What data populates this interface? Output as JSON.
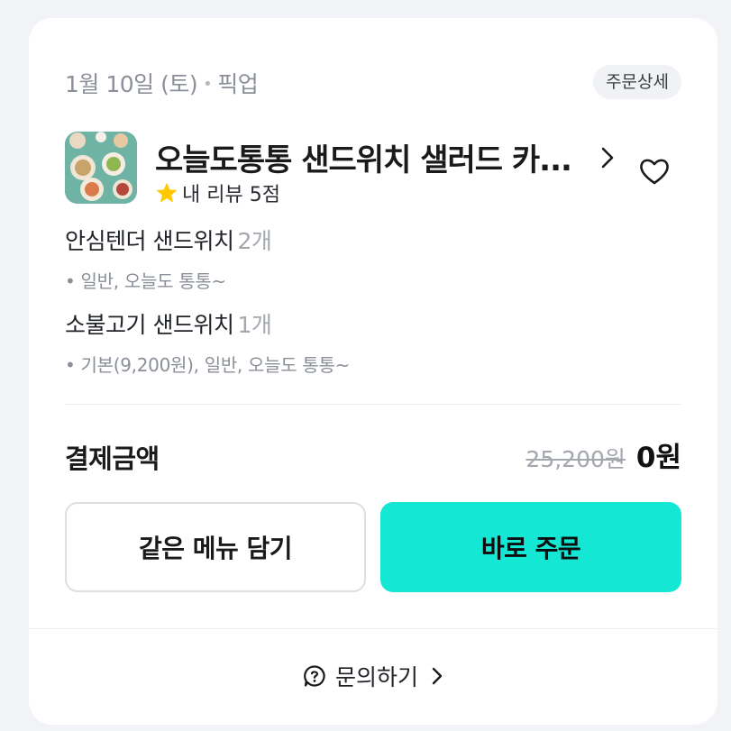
{
  "order": {
    "date": "1월 10일 (토)",
    "separator": "•",
    "type": "픽업",
    "detail_label": "주문상세"
  },
  "store": {
    "name": "오늘도통통 샌드위치 샐러드 카...",
    "review_label": "내 리뷰 5점",
    "rating": 5
  },
  "items": [
    {
      "name": "안심텐더 샌드위치",
      "qty": "2개",
      "options": "• 일반, 오늘도 통통~"
    },
    {
      "name": "소불고기 샌드위치",
      "qty": "1개",
      "options": "• 기본(9,200원), 일반, 오늘도 통통~"
    }
  ],
  "payment": {
    "label": "결제금액",
    "original": "25,200원",
    "final": "0원"
  },
  "buttons": {
    "reorder_same": "같은 메뉴 담기",
    "order_now": "바로 주문"
  },
  "inquiry": {
    "label": "문의하기"
  },
  "colors": {
    "accent": "#14e7d3",
    "star": "#ffc800",
    "muted_text": "#8a8f98"
  }
}
